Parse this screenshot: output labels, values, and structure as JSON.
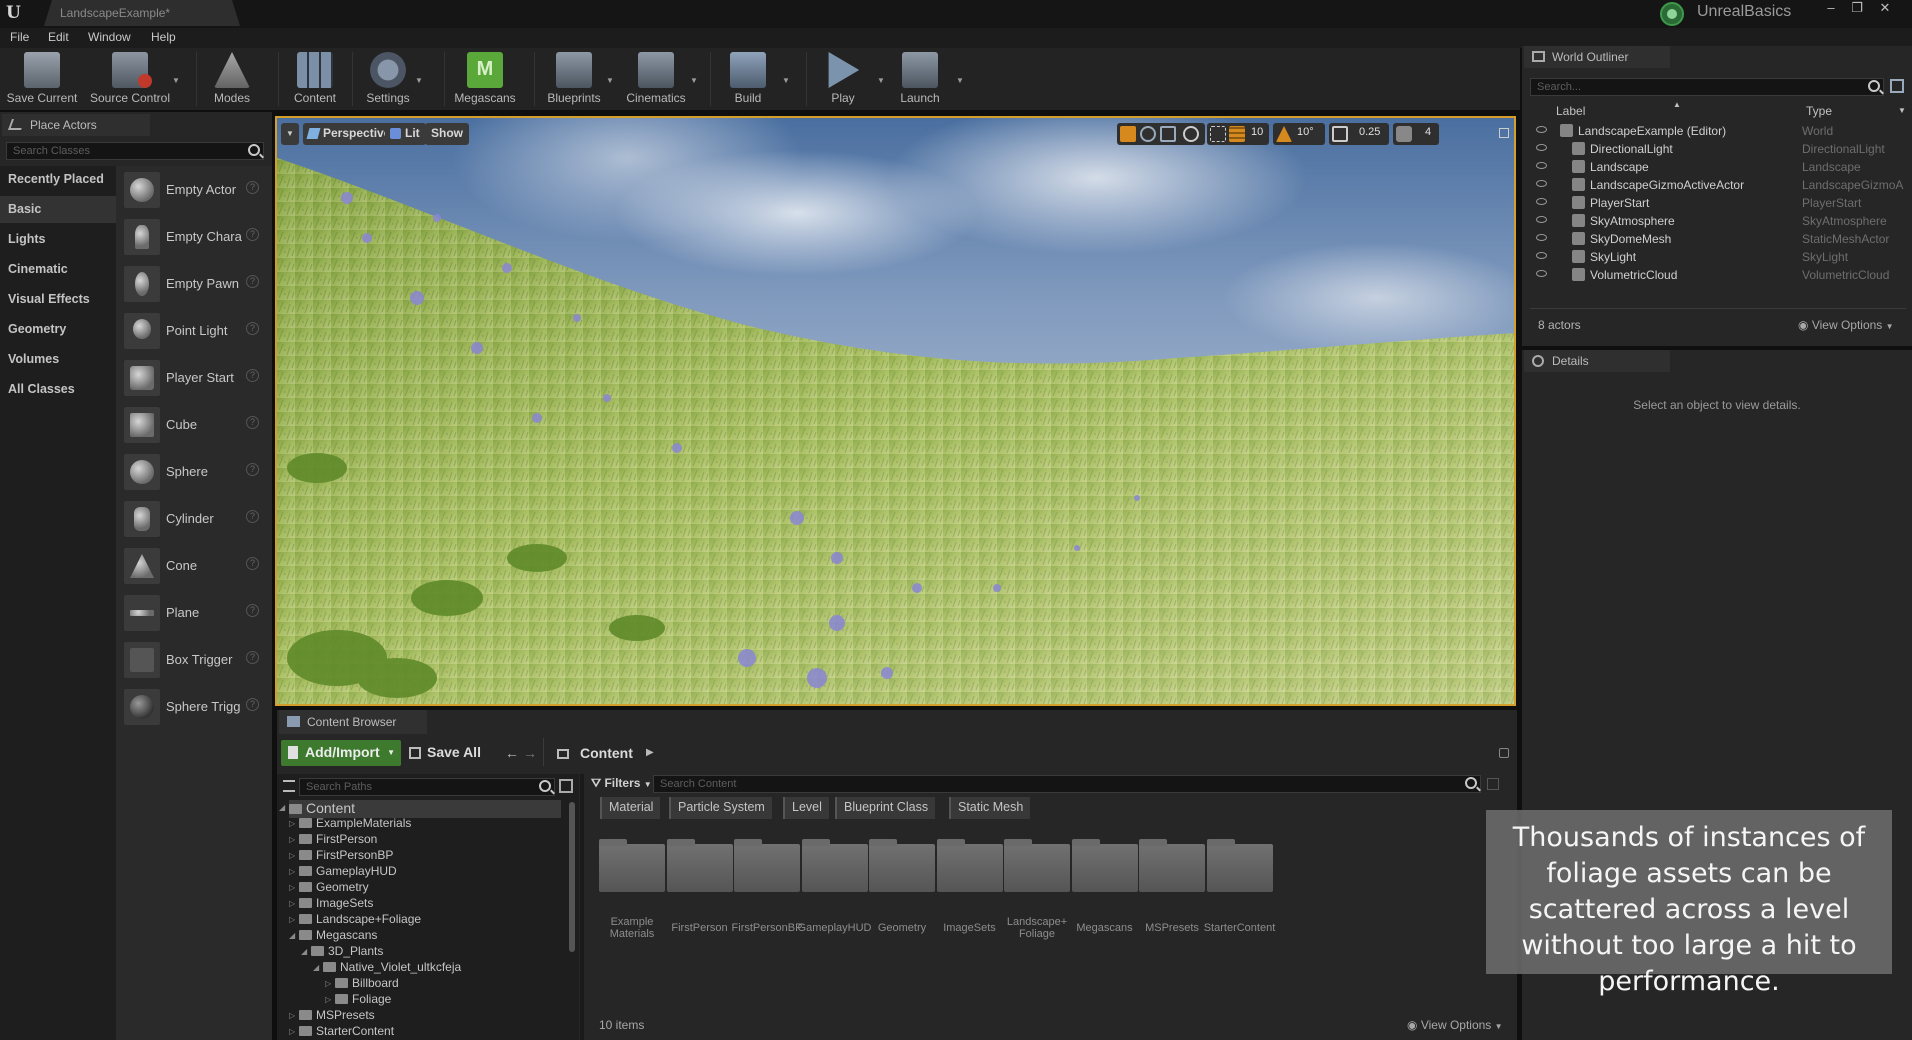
{
  "titlebar": {
    "doc_tab": "LandscapeExample*",
    "project_name": "UnrealBasics"
  },
  "menu": [
    "File",
    "Edit",
    "Window",
    "Help"
  ],
  "toolbar": {
    "save_current": "Save Current",
    "source_control": "Source Control",
    "modes": "Modes",
    "content": "Content",
    "settings": "Settings",
    "megascans": "Megascans",
    "blueprints": "Blueprints",
    "cinematics": "Cinematics",
    "build": "Build",
    "play": "Play",
    "launch": "Launch"
  },
  "place_actors": {
    "tab": "Place Actors",
    "search_placeholder": "Search Classes",
    "categories": [
      "Recently Placed",
      "Basic",
      "Lights",
      "Cinematic",
      "Visual Effects",
      "Geometry",
      "Volumes",
      "All Classes"
    ],
    "selected_category": "Basic",
    "actors": [
      "Empty Actor",
      "Empty Chara",
      "Empty Pawn",
      "Point Light",
      "Player Start",
      "Cube",
      "Sphere",
      "Cylinder",
      "Cone",
      "Plane",
      "Box Trigger",
      "Sphere Trigg"
    ]
  },
  "viewport": {
    "perspective": "Perspective",
    "lit": "Lit",
    "show": "Show",
    "grid_snap": "10",
    "rotation_snap": "10°",
    "scale_snap": "0.25",
    "camera_speed": "4"
  },
  "content_browser": {
    "tab": "Content Browser",
    "add_import": "Add/Import",
    "save_all": "Save All",
    "breadcrumb": "Content",
    "search_paths_placeholder": "Search Paths",
    "filters": "Filters",
    "search_content_placeholder": "Search Content",
    "filter_chips": [
      "Material",
      "Particle System",
      "Level",
      "Blueprint Class",
      "Static Mesh"
    ],
    "tree": [
      {
        "label": "Content",
        "depth": 0,
        "expanded": true
      },
      {
        "label": "ExampleMaterials",
        "depth": 1
      },
      {
        "label": "FirstPerson",
        "depth": 1
      },
      {
        "label": "FirstPersonBP",
        "depth": 1
      },
      {
        "label": "GameplayHUD",
        "depth": 1
      },
      {
        "label": "Geometry",
        "depth": 1
      },
      {
        "label": "ImageSets",
        "depth": 1
      },
      {
        "label": "Landscape+Foliage",
        "depth": 1
      },
      {
        "label": "Megascans",
        "depth": 1,
        "expanded": true
      },
      {
        "label": "3D_Plants",
        "depth": 2,
        "expanded": true
      },
      {
        "label": "Native_Violet_ultkcfeja",
        "depth": 3,
        "expanded": true
      },
      {
        "label": "Billboard",
        "depth": 4
      },
      {
        "label": "Foliage",
        "depth": 4
      },
      {
        "label": "MSPresets",
        "depth": 1
      },
      {
        "label": "StarterContent",
        "depth": 1
      }
    ],
    "assets": [
      [
        "Example",
        "Materials"
      ],
      [
        "FirstPerson"
      ],
      [
        "FirstPersonBP"
      ],
      [
        "GameplayHUD"
      ],
      [
        "Geometry"
      ],
      [
        "ImageSets"
      ],
      [
        "Landscape+",
        "Foliage"
      ],
      [
        "Megascans"
      ],
      [
        "MSPresets"
      ],
      [
        "StarterContent"
      ]
    ],
    "items_count": "10 items",
    "view_options": "View Options"
  },
  "outliner": {
    "tab": "World Outliner",
    "search_placeholder": "Search...",
    "col_label": "Label",
    "col_type": "Type",
    "rows": [
      {
        "label": "LandscapeExample (Editor)",
        "type": "World",
        "indent": 0
      },
      {
        "label": "DirectionalLight",
        "type": "DirectionalLight",
        "indent": 1
      },
      {
        "label": "Landscape",
        "type": "Landscape",
        "indent": 1
      },
      {
        "label": "LandscapeGizmoActiveActor",
        "type": "LandscapeGizmoA",
        "indent": 1
      },
      {
        "label": "PlayerStart",
        "type": "PlayerStart",
        "indent": 1
      },
      {
        "label": "SkyAtmosphere",
        "type": "SkyAtmosphere",
        "indent": 1
      },
      {
        "label": "SkyDomeMesh",
        "type": "StaticMeshActor",
        "indent": 1
      },
      {
        "label": "SkyLight",
        "type": "SkyLight",
        "indent": 1
      },
      {
        "label": "VolumetricCloud",
        "type": "VolumetricCloud",
        "indent": 1
      }
    ],
    "actors_count": "8 actors",
    "view_options": "View Options"
  },
  "details": {
    "tab": "Details",
    "message": "Select an object to view details."
  },
  "caption": "Thousands of instances of foliage assets can be scattered across a level without too large a hit to performance.",
  "colors": {
    "accent_viewport_border": "#d39f2a",
    "add_import_green": "#3e7a2e"
  }
}
